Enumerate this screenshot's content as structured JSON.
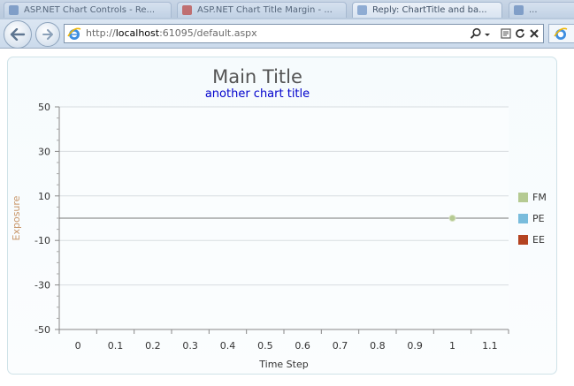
{
  "browser": {
    "tabs": [
      {
        "label": "ASP.NET Chart Controls - Re..."
      },
      {
        "label": "ASP.NET Chart Title Margin - ..."
      },
      {
        "label": "Reply: ChartTitle and ba..."
      },
      {
        "label": "..."
      }
    ],
    "url_prefix": "http://",
    "url_host": "localhost",
    "url_rest": ":61095/default.aspx",
    "colors": {
      "chrome": "#c9d6e6",
      "address_border": "#7f94ad"
    }
  },
  "chart_data": {
    "type": "scatter",
    "title": "Main Title",
    "subtitle": "another chart title",
    "xlabel": "Time Step",
    "ylabel": "Exposure",
    "xlim": [
      -0.05,
      1.15
    ],
    "ylim": [
      -50,
      50
    ],
    "xticks": [
      0,
      0.1,
      0.2,
      0.3,
      0.4,
      0.5,
      0.6,
      0.7,
      0.8,
      0.9,
      1,
      1.1
    ],
    "xtick_labels": [
      "0",
      "0.1",
      "0.2",
      "0.3",
      "0.4",
      "0.5",
      "0.6",
      "0.7",
      "0.8",
      "0.9",
      "1",
      "1.1"
    ],
    "yticks": [
      50,
      30,
      10,
      -10,
      -30,
      -50
    ],
    "ytick_labels": [
      "50",
      "30",
      "10",
      "-10",
      "-30",
      "-50"
    ],
    "grid": true,
    "zero_line": true,
    "legend_position": "right",
    "series": [
      {
        "name": "FM",
        "color": "#b5ca92",
        "points": [
          {
            "x": 1,
            "y": 0
          }
        ]
      },
      {
        "name": "PE",
        "color": "#79bcdc",
        "points": []
      },
      {
        "name": "EE",
        "color": "#b44321",
        "points": []
      }
    ],
    "colors": {
      "title": "#555555",
      "subtitle": "#0000cc",
      "ylabel": "#c8966a",
      "grid": "#d8dde0",
      "axis": "#888888"
    }
  }
}
